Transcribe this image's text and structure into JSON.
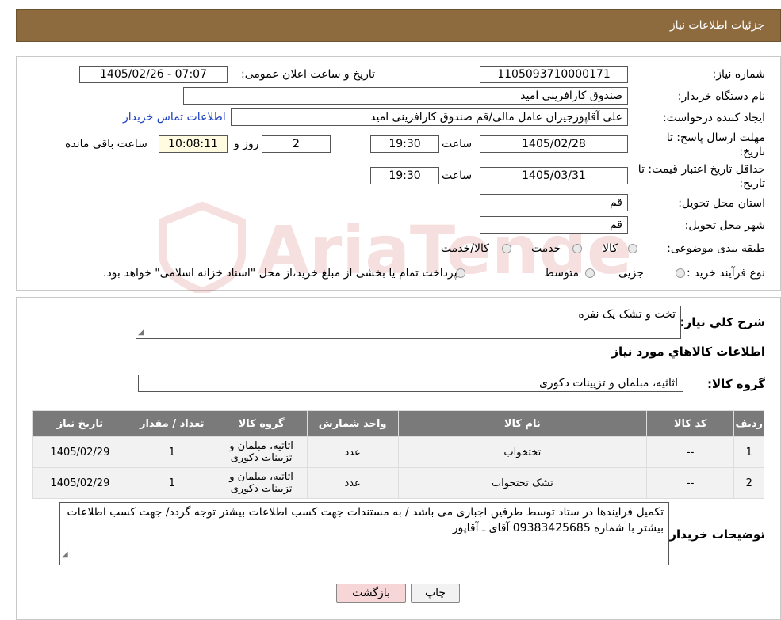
{
  "header": {
    "title": "جزئیات اطلاعات نیاز"
  },
  "watermark": {
    "text": "AriaTender.neT"
  },
  "form": {
    "need_number_label": "شماره نیاز:",
    "need_number": "1105093710000171",
    "announce_label": "تاریخ و ساعت اعلان عمومی:",
    "announce_value": "1405/02/26 - 07:07",
    "buyer_org_label": "نام دستگاه خریدار:",
    "buyer_org": "صندوق کارافرینی امید",
    "creator_label": "ایجاد کننده درخواست:",
    "creator": "علی آقاپورجیران عامل مالی/قم صندوق کارافرینی امید",
    "contact_link": "اطلاعات تماس خریدار",
    "deadline_label_1": "مهلت ارسال پاسخ: تا",
    "deadline_label_2": "تاریخ:",
    "deadline_date": "1405/02/28",
    "time_label": "ساعت",
    "deadline_time": "19:30",
    "days_value": "2",
    "days_label": "روز و",
    "remaining_time": "10:08:11",
    "remaining_label": "ساعت باقی مانده",
    "validity_label_1": "حداقل تاریخ اعتبار قیمت: تا",
    "validity_label_2": "تاریخ:",
    "validity_date": "1405/03/31",
    "validity_time_label": "ساعت",
    "validity_time": "19:30",
    "province_label": "استان محل تحویل:",
    "province": "قم",
    "city_label": "شهر محل تحویل:",
    "city": "قم",
    "category_label": "طبقه بندی موضوعی:",
    "category_options": [
      "کالا",
      "خدمت",
      "کالا/خدمت"
    ],
    "process_label": "نوع فرآیند خرید :",
    "process_options": [
      "جزیی",
      "متوسط"
    ],
    "process_note": "پرداخت تمام یا بخشی از مبلغ خرید،از محل \"اسناد خزانه اسلامی\" خواهد بود."
  },
  "summary": {
    "desc_label": "شرح کلي نياز:",
    "desc_value": "تخت و تشک یک نفره",
    "goods_title": "اطلاعات کالاهاي مورد نياز",
    "group_label": "گروه کالا:",
    "group_value": "اثاثیه، مبلمان و تزیینات دکوری"
  },
  "table": {
    "headers": [
      "رديف",
      "کد کالا",
      "نام کالا",
      "واحد شمارش",
      "گروه کالا",
      "تعداد / مقدار",
      "تاريخ نياز"
    ],
    "rows": [
      [
        "1",
        "--",
        "تختخواب",
        "عدد",
        "اثاثیه، مبلمان و تزیینات دکوری",
        "1",
        "1405/02/29"
      ],
      [
        "2",
        "--",
        "تشک تختخواب",
        "عدد",
        "اثاثیه، مبلمان و تزیینات دکوری",
        "1",
        "1405/02/29"
      ]
    ]
  },
  "notes": {
    "label": "توضیحات خریدار:",
    "value": "تکمیل فرایندها در ستاد توسط طرفین اجباری می باشد / به مستندات جهت کسب اطلاعات بیشتر توجه گردد/ جهت کسب اطلاعات بیشتر با شماره  09383425685 آقای ـ آقاپور"
  },
  "buttons": {
    "print": "چاپ",
    "back": "بازگشت"
  },
  "colors": {
    "header": "#8e6b3f",
    "table_header": "#7a7a7a",
    "link": "#1c3fbf",
    "back_button": "#f6d6d6"
  }
}
